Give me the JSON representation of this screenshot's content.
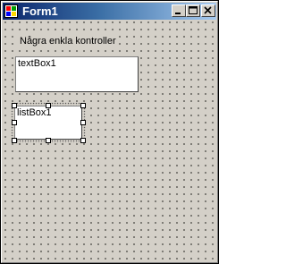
{
  "window": {
    "title": "Form1"
  },
  "titlebar_buttons": [
    "minimize",
    "maximize",
    "close"
  ],
  "form": {
    "label": {
      "text": "Några enkla kontroller"
    },
    "textbox": {
      "text": "textBox1"
    },
    "listbox": {
      "text": "listBox1",
      "selected_in_designer": true
    }
  },
  "colors": {
    "titlebar_start": "#0a246a",
    "titlebar_end": "#a6caf0",
    "window_face": "#d4d0c8"
  }
}
